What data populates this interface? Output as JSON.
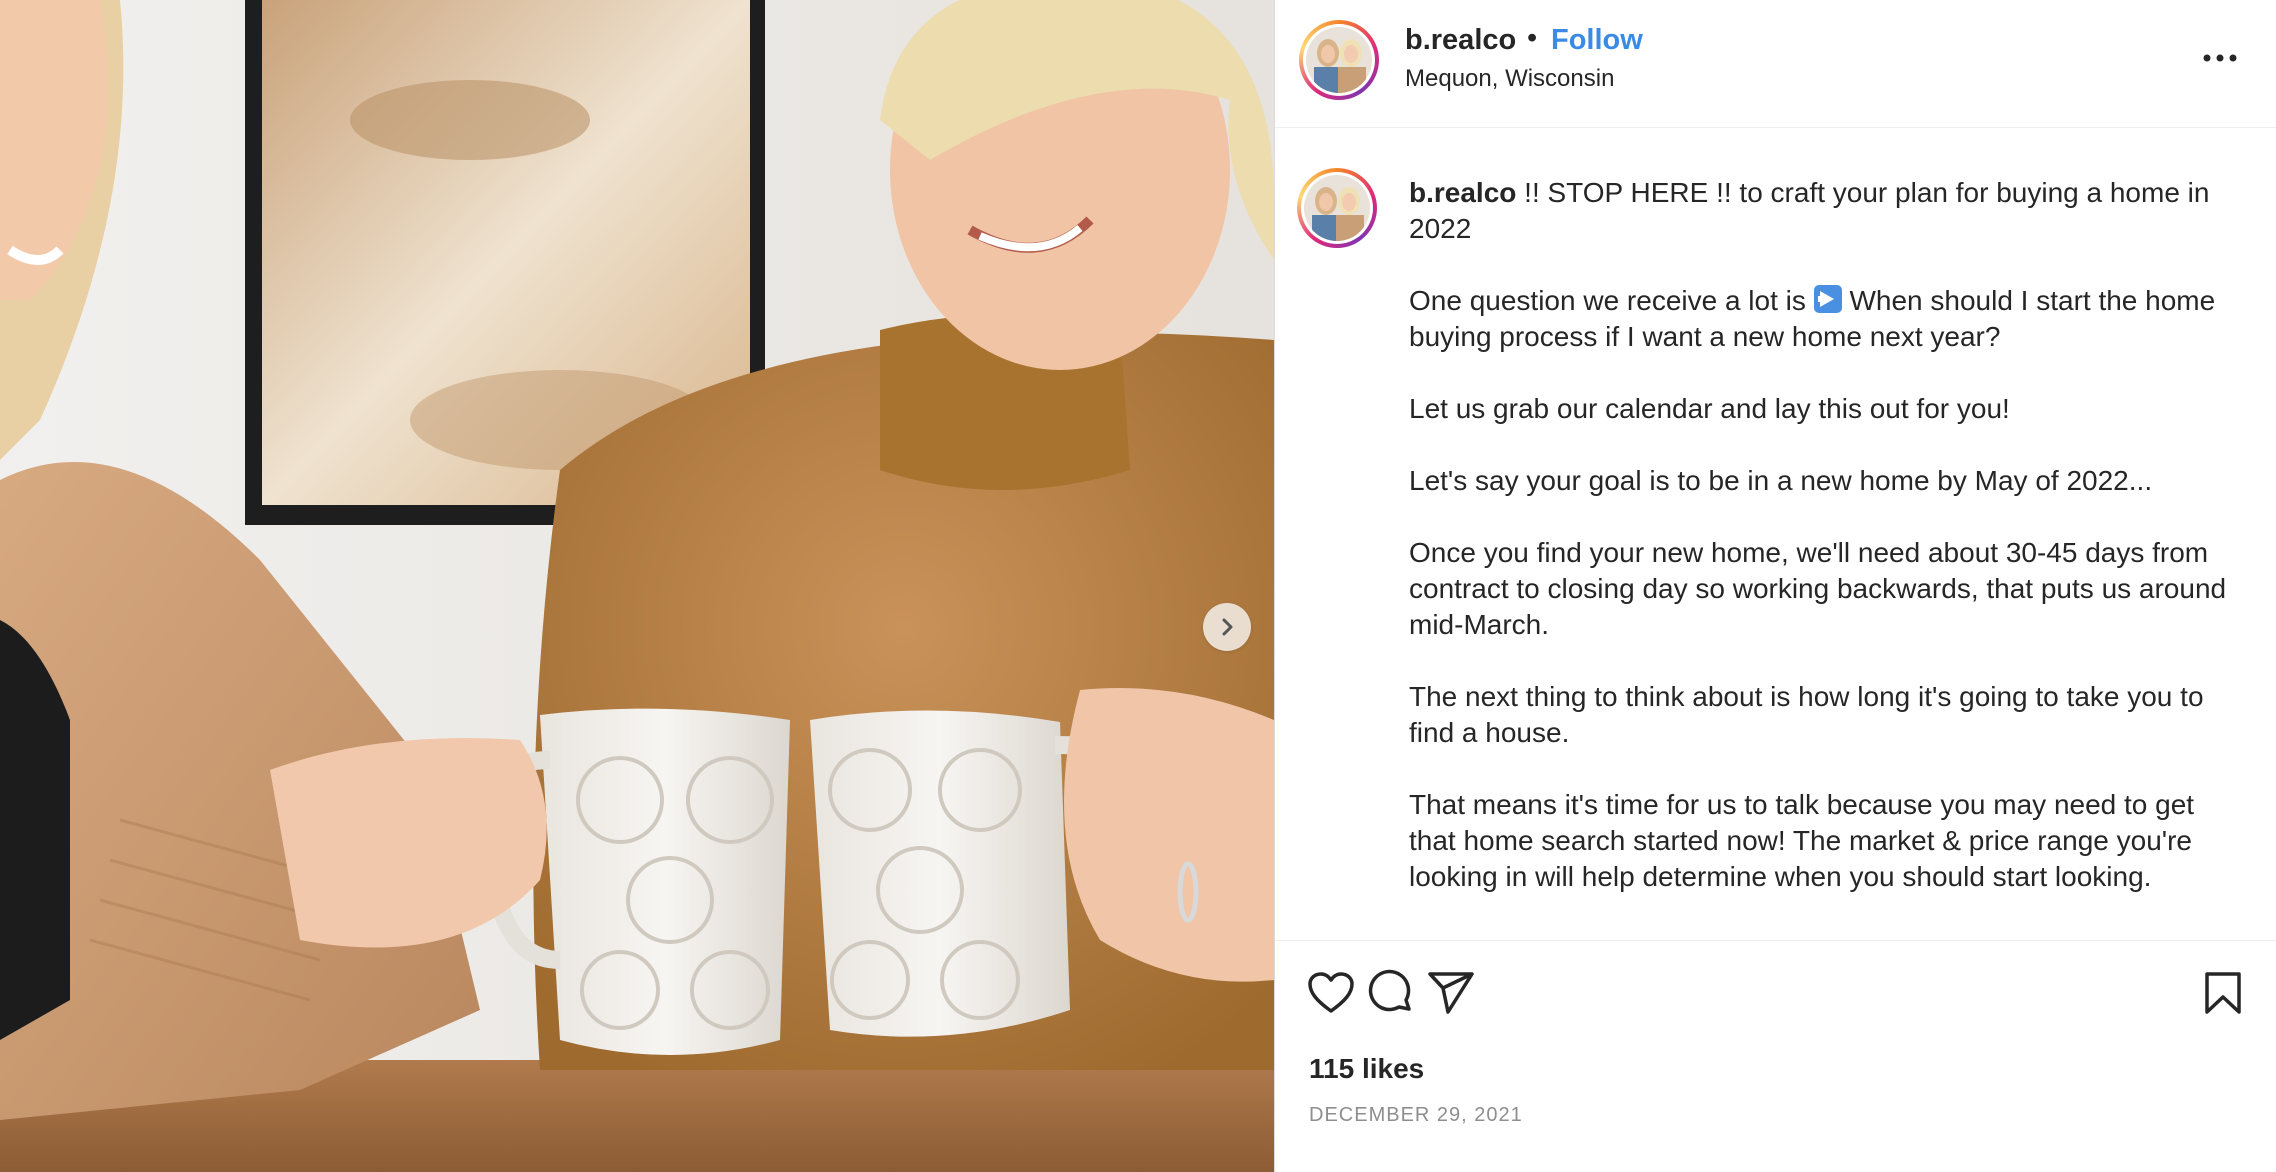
{
  "post": {
    "username": "b.realco",
    "separator": "•",
    "follow_label": "Follow",
    "location": "Mequon, Wisconsin"
  },
  "caption": {
    "username": "b.realco",
    "first_line": " !! STOP HERE !! to craft your plan for buying a home in 2022",
    "p2_before": "One question we receive a lot is ",
    "p2_after": " When should I start the home buying process if I want a new home next year?",
    "p3": "Let us grab our calendar and lay this out for you!",
    "p4": "Let's say your goal is to be in a new home by May of 2022...",
    "p5": "Once you find your new home, we'll need about 30-45 days from contract to closing day so working backwards, that puts us around mid-March.",
    "p6": "The next thing to think about is how long it's going to take you to find a house.",
    "p7": "That means it's time for us to talk because you may need to get that home search started now! The market & price range you're looking in will help determine when you should start looking."
  },
  "engagement": {
    "likes": "115 likes",
    "date": "DECEMBER 29, 2021"
  },
  "icons": {
    "like": "heart-icon",
    "comment": "comment-icon",
    "share": "paper-plane-icon",
    "save": "bookmark-icon",
    "more": "more-options-icon",
    "next": "chevron-right-icon"
  },
  "colors": {
    "follow": "#3b8be6",
    "text": "#262626",
    "muted": "#8e8e8e",
    "border": "#dbdbdb"
  }
}
